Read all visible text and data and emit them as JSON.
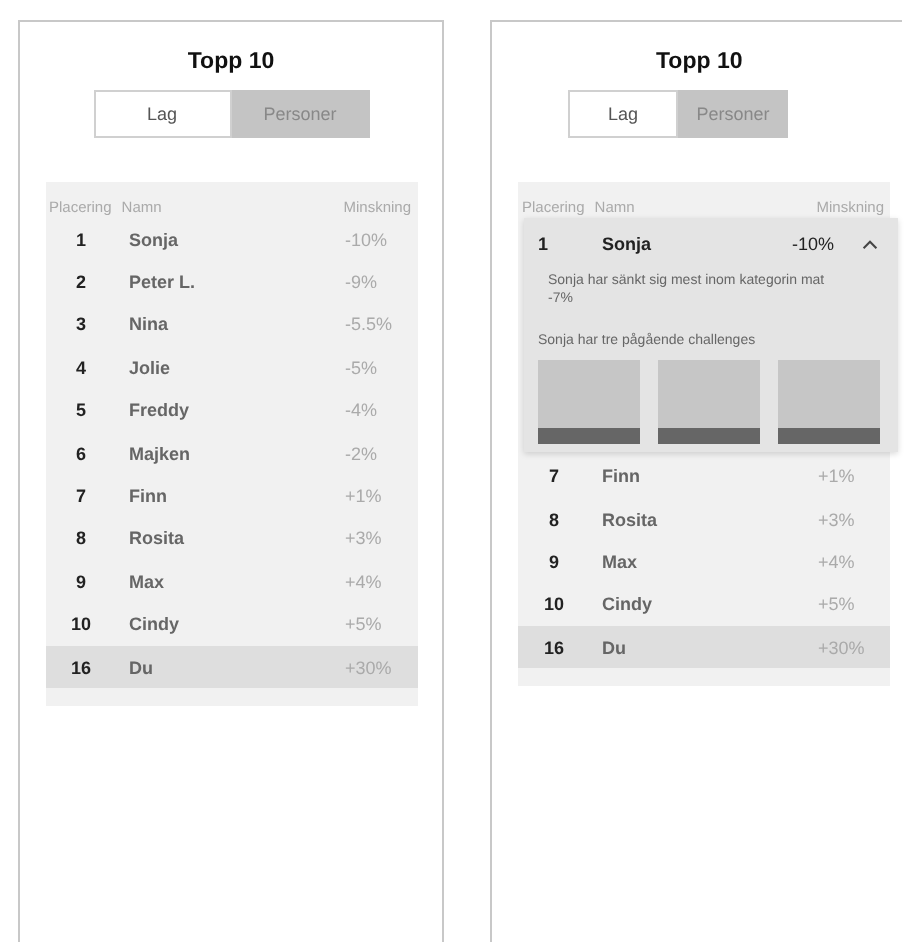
{
  "screens": [
    {
      "title": "Topp 10",
      "tabs": [
        {
          "label": "Lag",
          "selected": false
        },
        {
          "label": "Personer",
          "selected": true
        }
      ],
      "table": {
        "columns": [
          "Placering",
          "Namn",
          "Minskning"
        ],
        "rows": [
          {
            "rank": "1",
            "name": "Sonja",
            "change": "-10%",
            "highlighted": false
          },
          {
            "rank": "2",
            "name": "Peter L.",
            "change": "-9%",
            "highlighted": false
          },
          {
            "rank": "3",
            "name": "Nina",
            "change": "-5.5%",
            "highlighted": false
          },
          {
            "rank": "4",
            "name": "Jolie",
            "change": "-5%",
            "highlighted": false
          },
          {
            "rank": "5",
            "name": "Freddy",
            "change": "-4%",
            "highlighted": false
          },
          {
            "rank": "6",
            "name": "Majken",
            "change": "-2%",
            "highlighted": false
          },
          {
            "rank": "7",
            "name": "Finn",
            "change": "+1%",
            "highlighted": false
          },
          {
            "rank": "8",
            "name": "Rosita",
            "change": "+3%",
            "highlighted": false
          },
          {
            "rank": "9",
            "name": "Max",
            "change": "+4%",
            "highlighted": false
          },
          {
            "rank": "10",
            "name": "Cindy",
            "change": "+5%",
            "highlighted": false
          },
          {
            "rank": "16",
            "name": "Du",
            "change": "+30%",
            "highlighted": true
          }
        ]
      }
    },
    {
      "title": "Topp 10",
      "tabs": [
        {
          "label": "Lag",
          "selected": false
        },
        {
          "label": "Personer",
          "selected": true
        }
      ],
      "table": {
        "columns": [
          "Placering",
          "Namn",
          "Minskning"
        ],
        "popover": {
          "rank": "1",
          "name": "Sonja",
          "change": "-10%",
          "expanded": true,
          "text": "Sonja har sänkt sig mest inom kategorin mat -7%",
          "challenges_label": "Sonja har tre pågående challenges",
          "challenges": [
            {
              "kind": "card"
            },
            {
              "kind": "card"
            },
            {
              "kind": "card"
            }
          ]
        },
        "rows": [
          {
            "rank": "7",
            "name": "Finn",
            "change": "+1%",
            "highlighted": false
          },
          {
            "rank": "8",
            "name": "Rosita",
            "change": "+3%",
            "highlighted": false
          },
          {
            "rank": "9",
            "name": "Max",
            "change": "+4%",
            "highlighted": false
          },
          {
            "rank": "10",
            "name": "Cindy",
            "change": "+5%",
            "highlighted": false
          },
          {
            "rank": "16",
            "name": "Du",
            "change": "+30%",
            "highlighted": true
          }
        ]
      }
    }
  ]
}
